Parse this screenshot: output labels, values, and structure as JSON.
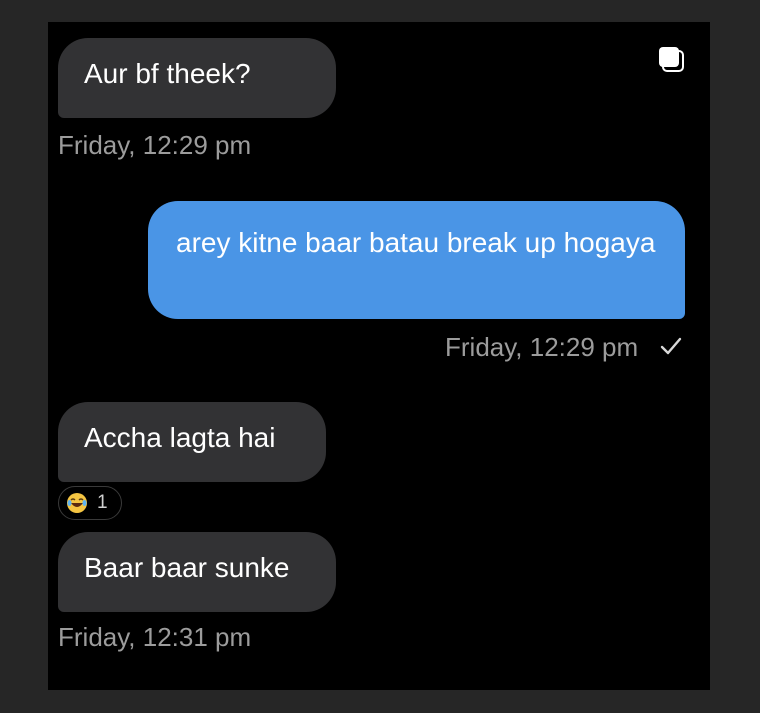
{
  "messages": [
    {
      "text": "Aur bf theek?",
      "timestamp": "Friday, 12:29 pm",
      "direction": "incoming"
    },
    {
      "text": "arey kitne baar batau break up hogaya",
      "timestamp": "Friday, 12:29 pm",
      "direction": "outgoing",
      "status": "sent"
    },
    {
      "text": "Accha lagta hai",
      "direction": "incoming",
      "reaction": {
        "emoji": "laughing-tears",
        "count": "1"
      }
    },
    {
      "text": "Baar baar sunke",
      "timestamp": "Friday, 12:31 pm",
      "direction": "incoming"
    }
  ],
  "colors": {
    "incoming_bubble": "#323234",
    "outgoing_bubble": "#4a95e6",
    "background": "#000000",
    "timestamp": "#9c9c9c"
  },
  "icons": [
    "copy-icon",
    "checkmark-icon",
    "laughing-emoji-icon"
  ]
}
